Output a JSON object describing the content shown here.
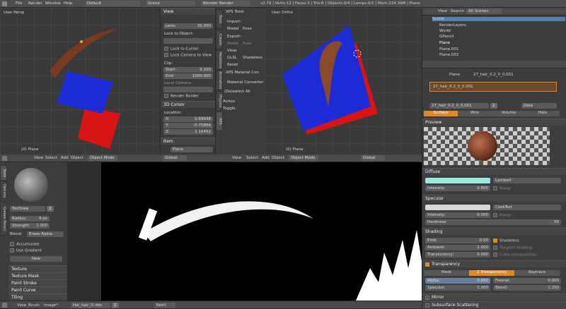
{
  "topbar": {
    "menus": [
      "File",
      "Render",
      "Window",
      "Help"
    ],
    "layout": "Default",
    "scene": "Scene",
    "engine": "Blender Render",
    "stats": "v2.79 | Verts:12 | Faces:3 | Tris:6 | Objects:0/4 | Lamps:0/1 | Mem:224.39M | Plane"
  },
  "left_view": {
    "label": "User Persp",
    "object_label": "(0) Plane"
  },
  "right_view": {
    "label": "User Ortho",
    "object_label": "(0) Plane"
  },
  "n_panel": {
    "view_header": "View",
    "lens_label": "Lens:",
    "lens_value": "35.000",
    "lock_label": "Lock to Object:",
    "lock_cursor": "Lock to Cursor",
    "lock_camera": "Lock Camera to View",
    "clip_label": "Clip:",
    "clip_start_label": "Start:",
    "clip_start": "0.100",
    "clip_end_label": "End:",
    "clip_end": "1000.000",
    "local_camera": "Local Camera:",
    "render_border": "Render Border",
    "cursor_header": "3D Cursor",
    "location_label": "Location:",
    "x_label": "X:",
    "x_value": "0.69938",
    "y_label": "Y:",
    "y_value": "-0.75899",
    "z_label": "Z:",
    "z_value": "1.16452",
    "item_header": "Item",
    "item_name": "Plane"
  },
  "xps": {
    "header": "XPS Tools",
    "import_label": "Import:",
    "model": "Model",
    "pose": "Pose",
    "export_label": "Export:",
    "model2": "Model",
    "pose2": "Pose",
    "view_label": "View:",
    "glsl": "GLSL",
    "shadeless": "Shadeless",
    "reset": "Reset",
    "material_header": "XPS Material Con",
    "material_converter": "Material Converter",
    "deselect_all": "(De)select All",
    "action_label": "Action",
    "toggle": "Toggle"
  },
  "side_tabs": [
    "Tools",
    "Create",
    "Relations",
    "Animation",
    "Physics",
    "XPS"
  ],
  "header3d": {
    "view": "View",
    "select": "Select",
    "add": "Add",
    "object": "Object",
    "mode": "Object Mode",
    "global": "Global"
  },
  "paint": {
    "brush": "TexDraw",
    "brush_num": "2",
    "radius_label": "Radius:",
    "radius_value": "9 px",
    "strength_label": "Strength:",
    "strength_value": "1.000",
    "blend_label": "Blend:",
    "blend_value": "Erase Alpha",
    "accumulate": "Accumulate",
    "use_gradient": "Use Gradient",
    "new_btn": "New",
    "texture": "Texture",
    "texture_mask": "Texture Mask",
    "paint_stroke": "Paint Stroke",
    "paint_curve": "Paint Curve",
    "tiling": "Tiling",
    "tabs": [
      "Tools",
      "Options",
      "Grease Pencil"
    ]
  },
  "image_editor": {
    "view": "View",
    "brush": "Brush",
    "image": "Image*",
    "image_name": "Hai_hair_D.dds",
    "num": "2",
    "mode": "Paint"
  },
  "outliner": {
    "view": "View",
    "search": "Search",
    "scene_sel": "All Scenes",
    "items": [
      "Scene",
      "RenderLayers",
      "World",
      "GPencil",
      "Plane",
      "Plane.001",
      "Plane.002"
    ]
  },
  "properties": {
    "object_label": "Plane",
    "material_slot": "27_hair_0.2_0_0.001",
    "material_name": "27_hair_0.2_0_0.001",
    "users": "2",
    "data": "Data",
    "tabs": [
      "Surface",
      "Wire",
      "Volume",
      "Halo"
    ],
    "preview_header": "Preview",
    "diffuse_header": "Diffuse",
    "diffuse_shader": "Lambert",
    "diffuse_intensity_label": "Intensity:",
    "diffuse_intensity": "0.800",
    "ramp": "Ramp",
    "specular_header": "Specular",
    "spec_shader": "CookTorr",
    "spec_intensity_label": "Intensity:",
    "spec_intensity": "0.000",
    "hardness_label": "Hardness:",
    "hardness": "50",
    "shading_header": "Shading",
    "emit_label": "Emit:",
    "emit": "0.00",
    "ambient_label": "Ambient:",
    "ambient": "1.000",
    "translucency_label": "Translucency:",
    "translucency": "0.000",
    "shadeless": "Shadeless",
    "tangent": "Tangent Shading",
    "cubic": "Cubic Interpolation",
    "transparency_header": "Transparency",
    "trans_tabs": [
      "Mask",
      "Z Transparency",
      "Raytrace"
    ],
    "alpha_label": "Alpha:",
    "alpha": "0.000",
    "fresnel_label": "Fresnel:",
    "fresnel": "0.000",
    "specular_label": "Specular:",
    "specular": "1.000",
    "blend_label": "Blend:",
    "blend": "1.250",
    "mirror_header": "Mirror",
    "sss_header": "Subsurface Scattering"
  },
  "colors": {
    "accent": "#e08a27",
    "diffuse": "#9de8dc",
    "blue": "#1b2bd6",
    "red": "#d81414"
  }
}
